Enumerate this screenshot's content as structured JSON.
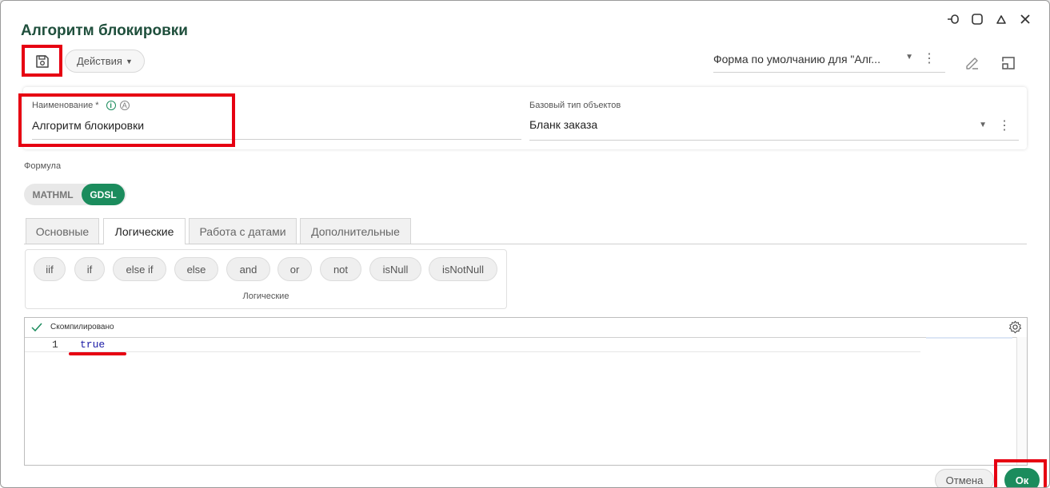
{
  "dialog": {
    "title": "Алгоритм блокировки",
    "window_controls": [
      "pin-icon",
      "maximize-icon",
      "collapse-icon",
      "close-icon"
    ]
  },
  "toolbar": {
    "save_icon": "save-icon",
    "actions_label": "Действия",
    "form_select_value": "Форма по умолчанию для \"Алг...",
    "edit_icon": "edit-icon",
    "layout_icon": "layout-icon"
  },
  "fields": {
    "name_label": "Наименование *",
    "name_value": "Алгоритм блокировки",
    "base_type_label": "Базовый тип объектов",
    "base_type_value": "Бланк заказа"
  },
  "formula": {
    "label": "Формула",
    "toggle": {
      "mathml": "MATHML",
      "gdsl": "GDSL",
      "selected": "GDSL"
    },
    "tabs": [
      {
        "label": "Основные",
        "active": false
      },
      {
        "label": "Логические",
        "active": true
      },
      {
        "label": "Работа с датами",
        "active": false
      },
      {
        "label": "Дополнительные",
        "active": false
      }
    ],
    "chips": [
      "iif",
      "if",
      "else if",
      "else",
      "and",
      "or",
      "not",
      "isNull",
      "isNotNull"
    ],
    "chips_caption": "Логические"
  },
  "editor": {
    "status": "Скомпилировано",
    "lines": [
      {
        "number": "1",
        "code": "true"
      }
    ]
  },
  "footer": {
    "cancel_label": "Отмена",
    "ok_label": "Ок"
  },
  "colors": {
    "accent": "#1b8c5d",
    "title": "#1f4f3c",
    "highlight": "#e60012",
    "code": "#1a1aa6"
  }
}
